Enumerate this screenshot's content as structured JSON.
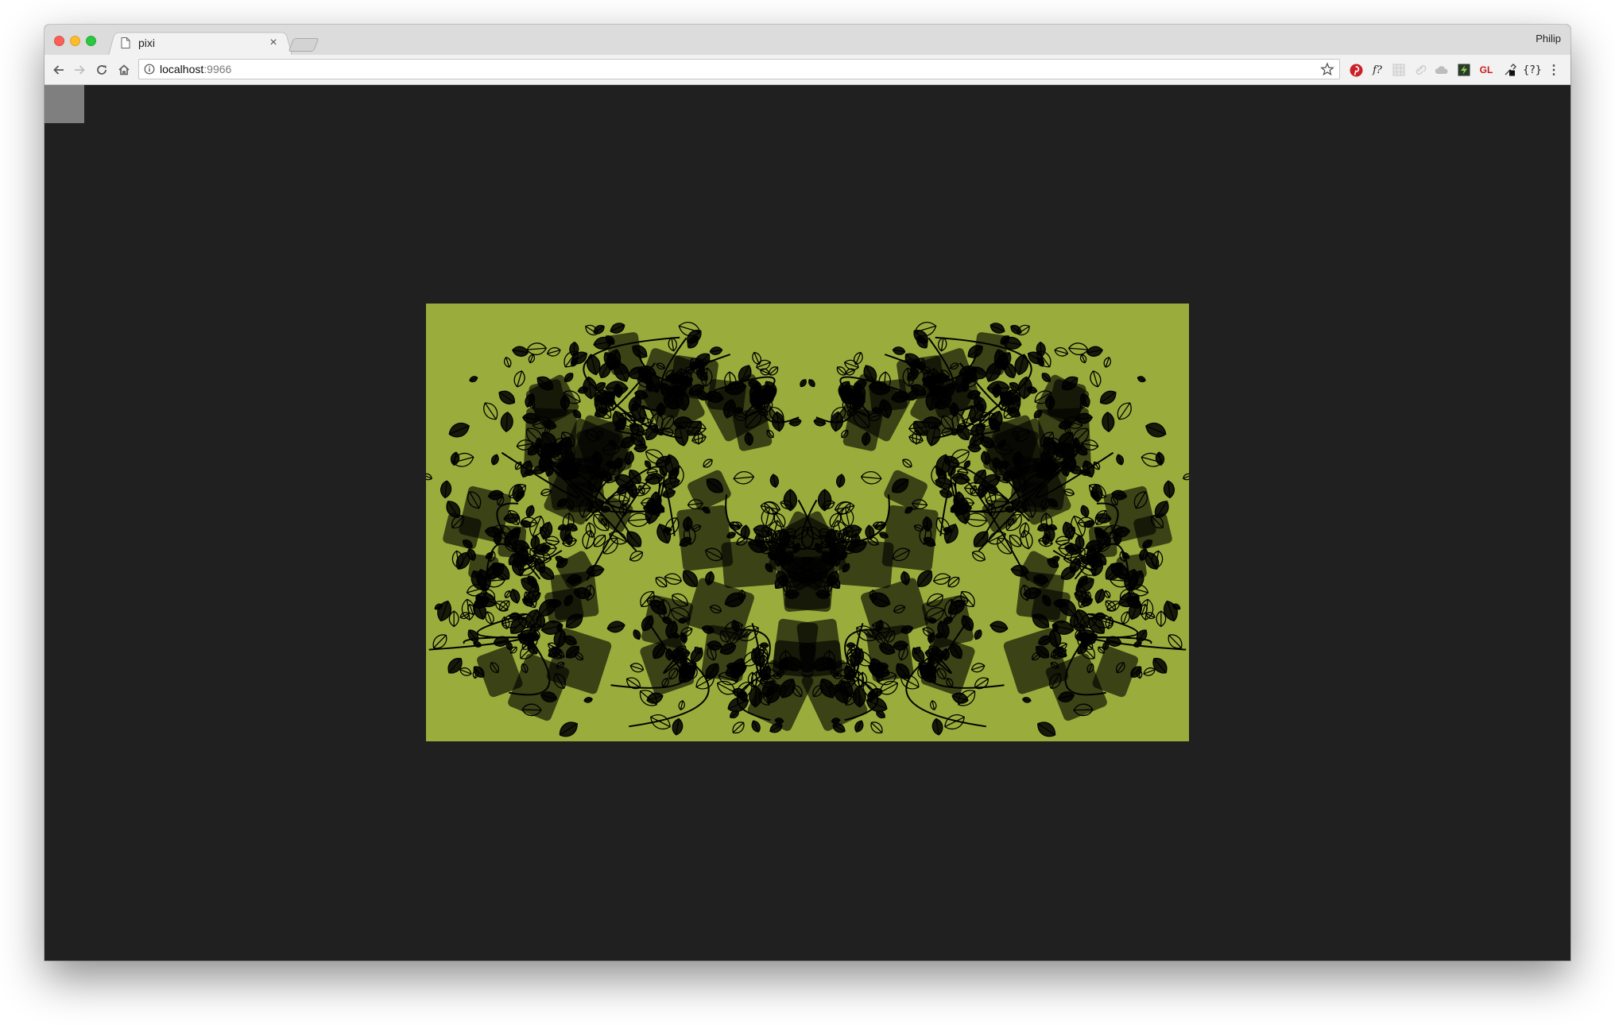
{
  "browser": {
    "tab": {
      "title": "pixi",
      "close_glyph": "×"
    },
    "profile_name": "Philip",
    "address_bar": {
      "host": "localhost",
      "port": ":9966"
    },
    "nav": {
      "back_icon": "arrow-left-icon",
      "forward_icon": "arrow-right-icon",
      "reload_icon": "reload-icon",
      "home_icon": "home-icon"
    },
    "extensions": {
      "fonts_label": "f?",
      "gl_label": "GL",
      "braces_label": "{?}",
      "menu_glyph": "⋮"
    }
  },
  "canvas": {
    "background": "#202020",
    "stage_color": "#9aad3c",
    "pattern_color": "#000000",
    "corner_box_color": "#7f7f7f"
  }
}
